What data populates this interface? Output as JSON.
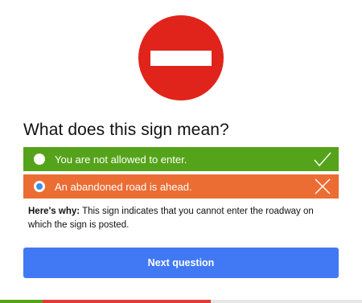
{
  "question": {
    "text": "What does this sign mean?"
  },
  "sign": {
    "icon": "do-not-enter-sign",
    "circle_color": "#e0241b",
    "bar_color": "#ffffff"
  },
  "answers": [
    {
      "label": "You are not allowed to enter.",
      "status": "correct",
      "selected": false,
      "color": "#55a31a",
      "mark_icon": "check-icon"
    },
    {
      "label": "An abandoned road is ahead.",
      "status": "wrong",
      "selected": true,
      "color": "#eb6d34",
      "mark_icon": "cross-icon"
    }
  ],
  "explanation": {
    "prefix": "Here's why:",
    "text": " This sign indicates that you cannot enter the roadway on which the sign is posted."
  },
  "next_button": {
    "label": "Next question",
    "color": "#4179f4"
  },
  "progress": {
    "track_color": "#e6e6e6",
    "segments": [
      {
        "status": "correct",
        "fraction": 0.118,
        "color": "#55a31a"
      },
      {
        "status": "wrong",
        "fraction": 0.464,
        "color": "#e53935"
      }
    ]
  }
}
